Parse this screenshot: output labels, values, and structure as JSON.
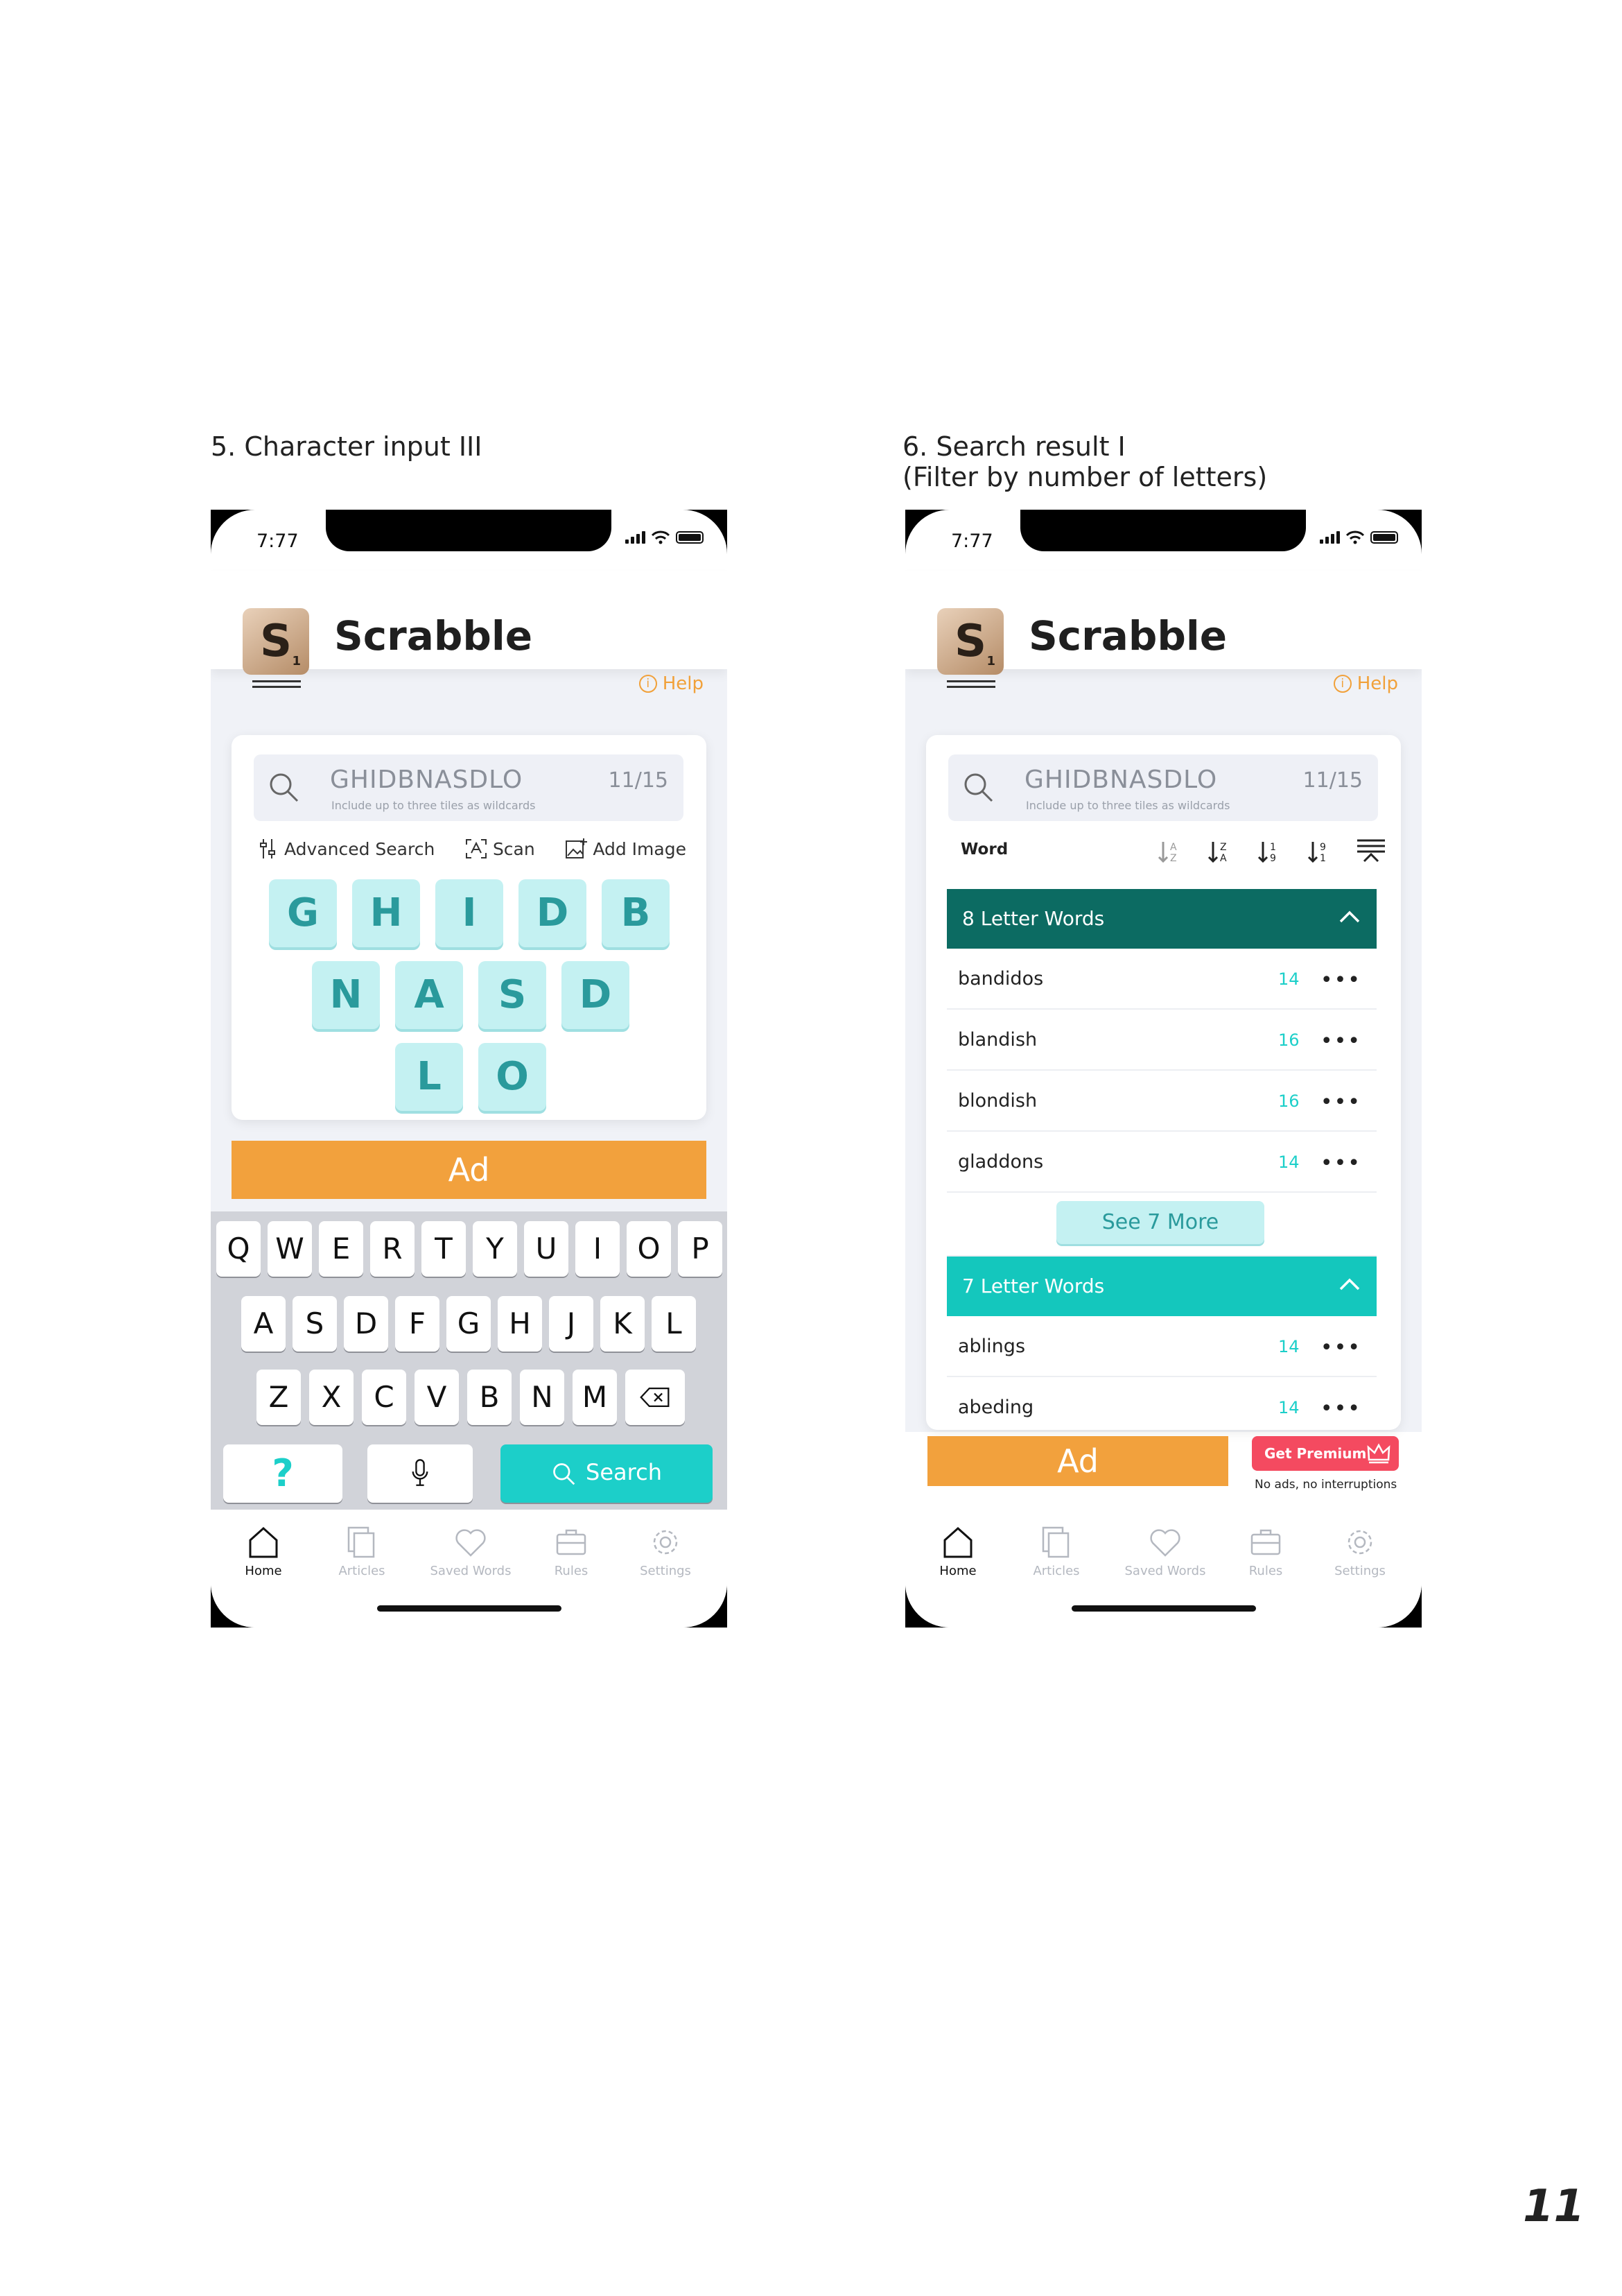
{
  "captions": {
    "left": "5. Character input III",
    "right_line1": "6. Search result I",
    "right_line2": "(Filter by number of letters)"
  },
  "status": {
    "time": "7:77"
  },
  "app": {
    "title": "Scrabble",
    "logo_letter": "S",
    "logo_value": "1",
    "help": "Help"
  },
  "search": {
    "query": "GHIDBNASDLO",
    "hint": "Include up to three tiles as wildcards",
    "count": "11/15"
  },
  "options": {
    "advanced": "Advanced Search",
    "scan": "Scan",
    "add_image": "Add Image"
  },
  "tiles": [
    [
      "G",
      "H",
      "I",
      "D",
      "B"
    ],
    [
      "N",
      "A",
      "S",
      "D"
    ],
    [
      "L",
      "O"
    ]
  ],
  "ad_label": "Ad",
  "keyboard": {
    "row1": [
      "Q",
      "W",
      "E",
      "R",
      "T",
      "Y",
      "U",
      "I",
      "O",
      "P"
    ],
    "row2": [
      "A",
      "S",
      "D",
      "F",
      "G",
      "H",
      "J",
      "K",
      "L"
    ],
    "row3": [
      "Z",
      "X",
      "C",
      "V",
      "B",
      "N",
      "M"
    ],
    "help_key": "?",
    "search_key": "Search"
  },
  "tabs": [
    {
      "label": "Home",
      "icon": "home-icon"
    },
    {
      "label": "Articles",
      "icon": "articles-icon"
    },
    {
      "label": "Saved Words",
      "icon": "heart-icon"
    },
    {
      "label": "Rules",
      "icon": "briefcase-icon"
    },
    {
      "label": "Settings",
      "icon": "gear-icon"
    }
  ],
  "results": {
    "sort_label": "Word",
    "group1": {
      "title": "8 Letter Words",
      "color": "#0c6b62",
      "words": [
        {
          "word": "bandidos",
          "score": "14"
        },
        {
          "word": "blandish",
          "score": "16"
        },
        {
          "word": "blondish",
          "score": "16"
        },
        {
          "word": "gladdons",
          "score": "14"
        }
      ],
      "see_more": "See 7 More"
    },
    "group2": {
      "title": "7 Letter Words",
      "color": "#14c7bd",
      "words": [
        {
          "word": "ablings",
          "score": "14"
        },
        {
          "word": "abeding",
          "score": "14"
        }
      ]
    },
    "more_icon": "•••"
  },
  "premium": {
    "label": "Get Premium",
    "sub": "No ads, no interruptions"
  },
  "page_number": "11",
  "colors": {
    "accent": "#1ccfc9",
    "ad": "#f2a13d",
    "premium": "#f44a60",
    "help": "#f1a13a"
  }
}
